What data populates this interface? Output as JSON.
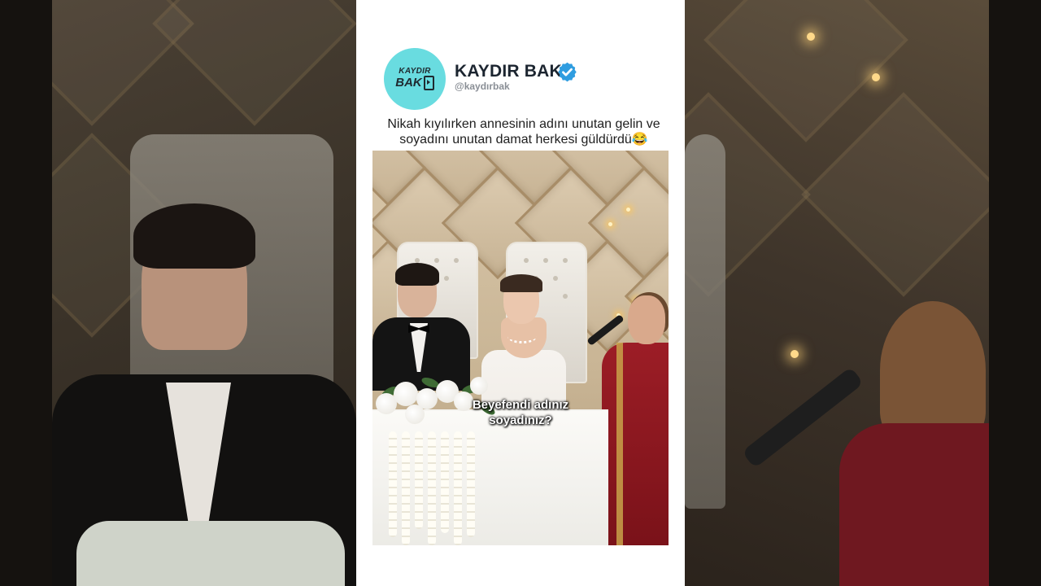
{
  "channel": {
    "name": "KAYDIR BAK",
    "handle": "@kaydırbak",
    "avatar_line1": "KAYDIR",
    "avatar_line2": "BAK",
    "verified_icon": "verified-badge-icon",
    "accent_color": "#69dce0",
    "verified_color": "#2f9de0"
  },
  "post": {
    "caption": "Nikah kıyılırken annesinin adını unutan gelin ve soyadını unutan damat herkesi güldürdü😂"
  },
  "video": {
    "subtitle_line1": "Beyefendi adınız",
    "subtitle_line2": "soyadınız?"
  }
}
